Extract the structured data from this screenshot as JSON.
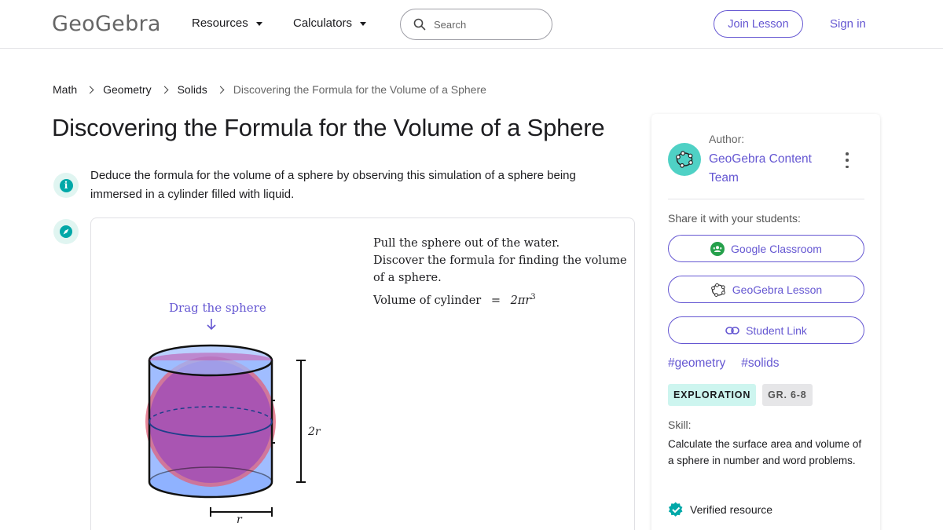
{
  "header": {
    "logo_text": "GeoGebra",
    "nav": [
      {
        "label": "Resources"
      },
      {
        "label": "Calculators"
      }
    ],
    "search_placeholder": "Search",
    "join_label": "Join Lesson",
    "signin_label": "Sign in"
  },
  "breadcrumb": [
    "Math",
    "Geometry",
    "Solids",
    "Discovering the Formula for the Volume of a Sphere"
  ],
  "page_title": "Discovering the Formula for the Volume of a Sphere",
  "description": "Deduce the formula for the volume of a sphere by observing this simulation of a sphere being immersed in a cylinder filled with liquid.",
  "applet": {
    "instructions": [
      "Pull the sphere out of the water.",
      "Discover the formula for finding the volume",
      "of a sphere."
    ],
    "volume_label": "Volume of cylinder",
    "volume_eq": "=",
    "volume_formula": "2πr",
    "volume_exp": "3",
    "drag_label": "Drag the sphere",
    "height_label": "2r",
    "radius_label": "r"
  },
  "sidebar": {
    "author_label": "Author:",
    "author_name": "GeoGebra Content Team",
    "share_label": "Share it with your students:",
    "share_buttons": [
      {
        "label": "Google Classroom",
        "icon": "google-classroom-icon"
      },
      {
        "label": "GeoGebra Lesson",
        "icon": "geogebra-lesson-icon"
      },
      {
        "label": "Student Link",
        "icon": "link-icon"
      }
    ],
    "tags": [
      "#geometry",
      "#solids"
    ],
    "badges": [
      "EXPLORATION",
      "GR. 6-8"
    ],
    "skill_label": "Skill:",
    "skill_text": "Calculate the surface area and volume of a sphere in number and word problems.",
    "verified_label": "Verified resource"
  },
  "colors": {
    "accent": "#6557d2",
    "teal": "#00a8a8",
    "cylinder": "#7fa7ff",
    "sphere": "#b05fb2"
  }
}
